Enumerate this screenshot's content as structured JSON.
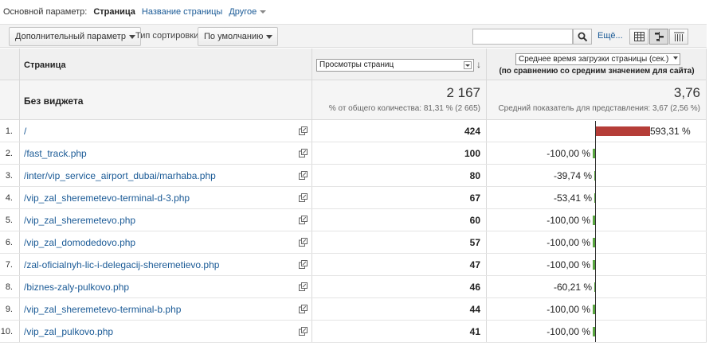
{
  "dimension_bar": {
    "primary_label": "Основной параметр:",
    "options": [
      "Страница",
      "Название страницы",
      "Другое"
    ],
    "active_index": 0
  },
  "toolbar": {
    "secondary_dimension": "Дополнительный параметр",
    "sort_type_label": "Тип сортировки:",
    "sort_type_value": "По умолчанию",
    "search_placeholder": "",
    "more_link": "Ещё..."
  },
  "table": {
    "page_column_header": "Страница",
    "metric1": "Просмотры страниц",
    "metric2": "Среднее время загрузки страницы (сек.)",
    "metric2_compare": "(по сравнению со средним значением для сайта)",
    "summary": {
      "title": "Без виджета",
      "views_total": "2 167",
      "views_sub": "% от общего количества: 81,31 % (2 665)",
      "load_avg": "3,76",
      "load_sub": "Средний показатель для представления: 3,67 (2,56 %)"
    },
    "rows": [
      {
        "num": "1.",
        "page": "/",
        "views": "424",
        "delta": "593,31 %",
        "delta_value": 593.31
      },
      {
        "num": "2.",
        "page": "/fast_track.php",
        "views": "100",
        "delta": "-100,00 %",
        "delta_value": -100
      },
      {
        "num": "3.",
        "page": "/inter/vip_service_airport_dubai/marhaba.php",
        "views": "80",
        "delta": "-39,74 %",
        "delta_value": -39.74
      },
      {
        "num": "4.",
        "page": "/vip_zal_sheremetevo-terminal-d-3.php",
        "views": "67",
        "delta": "-53,41 %",
        "delta_value": -53.41
      },
      {
        "num": "5.",
        "page": "/vip_zal_sheremetevo.php",
        "views": "60",
        "delta": "-100,00 %",
        "delta_value": -100
      },
      {
        "num": "6.",
        "page": "/vip_zal_domodedovo.php",
        "views": "57",
        "delta": "-100,00 %",
        "delta_value": -100
      },
      {
        "num": "7.",
        "page": "/zal-oficialnyh-lic-i-delegacij-sheremetievo.php",
        "views": "47",
        "delta": "-100,00 %",
        "delta_value": -100
      },
      {
        "num": "8.",
        "page": "/biznes-zaly-pulkovo.php",
        "views": "46",
        "delta": "-60,21 %",
        "delta_value": -60.21
      },
      {
        "num": "9.",
        "page": "/vip_zal_sheremetevo-terminal-b.php",
        "views": "44",
        "delta": "-100,00 %",
        "delta_value": -100
      },
      {
        "num": "10.",
        "page": "/vip_zal_pulkovo.php",
        "views": "41",
        "delta": "-100,00 %",
        "delta_value": -100
      }
    ]
  },
  "colors": {
    "link": "#1a5a96",
    "positive_bar": "#b53d38",
    "negative_bar": "#5aa641"
  }
}
